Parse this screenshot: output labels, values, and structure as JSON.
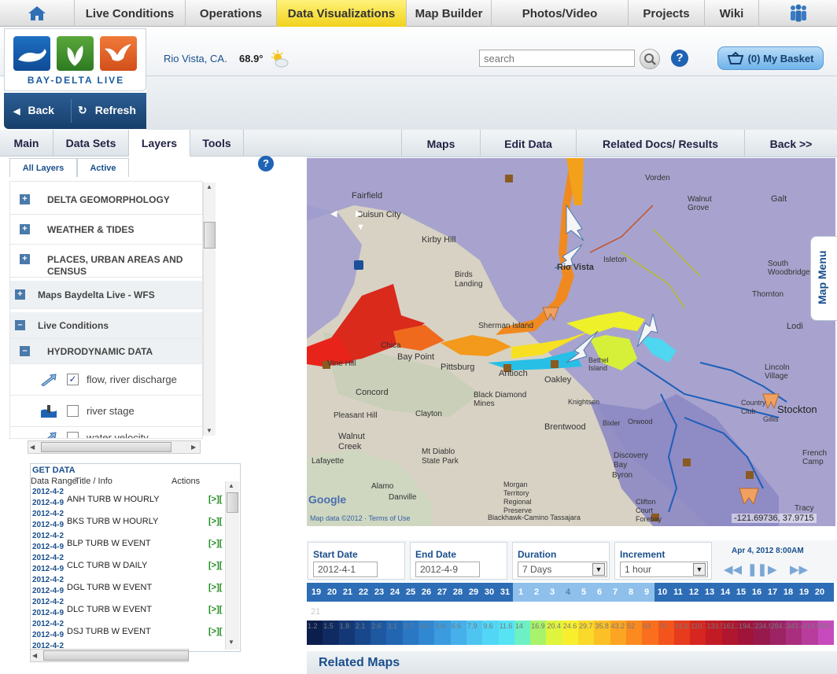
{
  "topnav": {
    "items": [
      "Live Conditions",
      "Operations",
      "Data Visualizations",
      "Map Builder",
      "Photos/Video",
      "Projects",
      "Wiki"
    ],
    "active": "Data Visualizations"
  },
  "header": {
    "logo_text": "BAY-DELTA LIVE",
    "location": "Rio Vista, CA.",
    "temperature": "68.9°",
    "search_placeholder": "search",
    "help": "?",
    "basket": "(0) My Basket"
  },
  "nav": {
    "back": "Back",
    "refresh": "Refresh"
  },
  "left_tabs": [
    "Main",
    "Data Sets",
    "Layers",
    "Tools"
  ],
  "left_tabs_active": "Layers",
  "sub_tabs": [
    "All Layers",
    "Active"
  ],
  "layers": {
    "groups": [
      "DELTA GEOMORPHOLOGY",
      "WEATHER & TIDES",
      "PLACES, URBAN AREAS AND CENSUS"
    ],
    "maps_wfs": "Maps Baydelta Live - WFS",
    "live_conditions": "Live Conditions",
    "hydrodynamic": "HYDRODYNAMIC DATA",
    "items": [
      {
        "label": "flow, river discharge",
        "checked": true
      },
      {
        "label": "river stage",
        "checked": false
      },
      {
        "label": "water velocity",
        "checked": false
      }
    ],
    "expand_symbol": "+",
    "collapse_symbol": "–"
  },
  "get_data": {
    "title": "GET DATA",
    "col_range": "Data Range",
    "col_title": "Title / Info",
    "col_actions": "Actions",
    "action": "[>][",
    "rows": [
      {
        "from": "2012-4-2",
        "to": "2012-4-9",
        "name": "ANH TURB W HOURLY"
      },
      {
        "from": "2012-4-2",
        "to": "2012-4-9",
        "name": "BKS TURB W HOURLY"
      },
      {
        "from": "2012-4-2",
        "to": "2012-4-9",
        "name": "BLP TURB W EVENT"
      },
      {
        "from": "2012-4-2",
        "to": "2012-4-9",
        "name": "CLC TURB W DAILY"
      },
      {
        "from": "2012-4-2",
        "to": "2012-4-9",
        "name": "DGL TURB W EVENT"
      },
      {
        "from": "2012-4-2",
        "to": "2012-4-9",
        "name": "DLC TURB W EVENT"
      },
      {
        "from": "2012-4-2",
        "to": "2012-4-9",
        "name": "DSJ TURB W EVENT"
      },
      {
        "from": "2012-4-2",
        "to": "",
        "name": ""
      }
    ]
  },
  "right_tabs": [
    "Maps",
    "Edit Data",
    "Related Docs/ Results",
    "Back >>"
  ],
  "map": {
    "menu": "Map Menu",
    "coords": "-121.69736, 37.9715",
    "attribution": "Map data ©2012 · Terms of Use",
    "google": "Google",
    "labels": [
      {
        "t": "Fairfield"
      },
      {
        "t": "Suisun City"
      },
      {
        "t": "Kirby Hill"
      },
      {
        "t": "Birds Landing"
      },
      {
        "t": "Rio Vista"
      },
      {
        "t": "Isleton"
      },
      {
        "t": "Walnut Grove"
      },
      {
        "t": "Galt"
      },
      {
        "t": "South Woodbridge"
      },
      {
        "t": "Lodi"
      },
      {
        "t": "Sherman Island"
      },
      {
        "t": "Bay Point"
      },
      {
        "t": "Pittsburg"
      },
      {
        "t": "Antioch"
      },
      {
        "t": "Oakley"
      },
      {
        "t": "Bethel Island"
      },
      {
        "t": "Concord"
      },
      {
        "t": "Clayton"
      },
      {
        "t": "Pleasant Hill"
      },
      {
        "t": "Walnut Creek"
      },
      {
        "t": "Mt Diablo State Park"
      },
      {
        "t": "Brentwood"
      },
      {
        "t": "Discovery Bay"
      },
      {
        "t": "Byron"
      },
      {
        "t": "Knightsen"
      },
      {
        "t": "Stockton"
      },
      {
        "t": "Lincoln Village"
      },
      {
        "t": "Country Club"
      },
      {
        "t": "French Camp"
      },
      {
        "t": "Lafayette"
      },
      {
        "t": "Danville"
      },
      {
        "t": "Alamo"
      },
      {
        "t": "Clifton Court Forebay"
      },
      {
        "t": "Vine Hill"
      },
      {
        "t": "Black Diamond Mines"
      },
      {
        "t": "Morgan Territory Regional Preserve"
      },
      {
        "t": "Blackhawk-Camino Tassajara"
      },
      {
        "t": "Vorden"
      },
      {
        "t": "Thornton"
      },
      {
        "t": "Orwood"
      },
      {
        "t": "Bixler"
      },
      {
        "t": "Gillis"
      },
      {
        "t": "Tracy"
      },
      {
        "t": "Chica"
      }
    ]
  },
  "timeline": {
    "start_label": "Start Date",
    "start_value": "2012-4-1",
    "end_label": "End Date",
    "end_value": "2012-4-9",
    "duration_label": "Duration",
    "duration_value": "7 Days",
    "increment_label": "Increment",
    "increment_value": "1 hour",
    "current_time": "Apr 4, 2012 8:00AM",
    "days": [
      "19",
      "20",
      "21",
      "22",
      "23",
      "24",
      "25",
      "26",
      "27",
      "28",
      "29",
      "30",
      "31",
      "1",
      "2",
      "3",
      "4",
      "5",
      "6",
      "7",
      "8",
      "9",
      "10",
      "11",
      "12",
      "13",
      "14",
      "15",
      "16",
      "17",
      "18",
      "19",
      "20"
    ],
    "current_day_index": 16,
    "range_start_index": 13,
    "range_end_index": 21,
    "overflow_day": "21"
  },
  "scale": {
    "values": [
      "1.2",
      "1.5",
      "1.8",
      "2.1",
      "2.6",
      "3.1",
      "3.7",
      "4.5",
      "5.4",
      "6.6",
      "7.9",
      "9.6",
      "11.6",
      "14",
      "16.9",
      "20.4",
      "24.6",
      "29.7",
      "35.8",
      "43.2",
      "52",
      "63",
      "76",
      "91.8",
      "110.7",
      "133.5",
      "161.1",
      "194.3",
      "234.5",
      "284.3",
      "343.4",
      "414.5",
      "500"
    ],
    "colors": [
      "#0c1e4d",
      "#102b62",
      "#143876",
      "#18478b",
      "#1d58a0",
      "#2266b2",
      "#2a77c4",
      "#3188d2",
      "#3a9bdf",
      "#45b0e9",
      "#4ec4f1",
      "#52d6f5",
      "#56e3f3",
      "#6df0c4",
      "#a8f36a",
      "#dff43c",
      "#f7ef2e",
      "#f9d92a",
      "#fbc026",
      "#fca522",
      "#fb8a1f",
      "#f96f1d",
      "#f3541c",
      "#e63b1d",
      "#d6261f",
      "#c31b24",
      "#b0162d",
      "#a0143a",
      "#981a4d",
      "#9c2364",
      "#a92f7e",
      "#b83c9c",
      "#c84bbd"
    ]
  },
  "related_maps": "Related Maps"
}
